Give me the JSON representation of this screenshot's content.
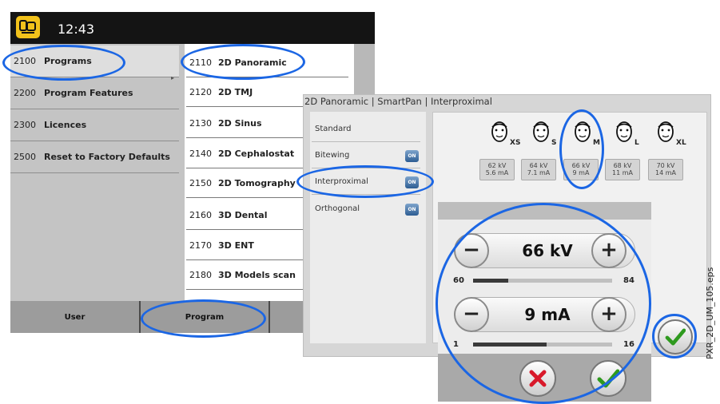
{
  "header": {
    "time": "12:43",
    "app_icon": "device-icon"
  },
  "left_menu": [
    {
      "code": "2100",
      "label": "Programs",
      "selected": true
    },
    {
      "code": "2200",
      "label": "Program Features"
    },
    {
      "code": "2300",
      "label": "Licences"
    },
    {
      "code": "2500",
      "label": "Reset to Factory Defaults"
    }
  ],
  "program_menu": [
    {
      "code": "2110",
      "label": "2D Panoramic"
    },
    {
      "code": "2120",
      "label": "2D TMJ"
    },
    {
      "code": "2130",
      "label": "2D Sinus"
    },
    {
      "code": "2140",
      "label": "2D Cephalostat"
    },
    {
      "code": "2150",
      "label": "2D Tomography"
    },
    {
      "code": "2160",
      "label": "3D Dental"
    },
    {
      "code": "2170",
      "label": "3D ENT"
    },
    {
      "code": "2180",
      "label": "3D Models scan"
    }
  ],
  "bottom_tabs": [
    {
      "label": "User"
    },
    {
      "label": "Program"
    }
  ],
  "panel": {
    "title": "2D Panoramic | SmartPan | Interproximal",
    "options": [
      {
        "label": "Standard",
        "badge": ""
      },
      {
        "label": "Bitewing",
        "badge": "ON"
      },
      {
        "label": "Interproximal",
        "badge": "ON"
      },
      {
        "label": "Orthogonal",
        "badge": "ON"
      }
    ],
    "patient_sizes": [
      {
        "size": "XS",
        "kv": "62 kV",
        "ma": "5.6 mA"
      },
      {
        "size": "S",
        "kv": "64 kV",
        "ma": "7.1 mA"
      },
      {
        "size": "M",
        "kv": "66 kV",
        "ma": "9 mA"
      },
      {
        "size": "L",
        "kv": "68 kV",
        "ma": "11 mA"
      },
      {
        "size": "XL",
        "kv": "70 kV",
        "ma": "14 mA"
      }
    ],
    "kv_control": {
      "value": "66 kV",
      "min": "60",
      "max": "84",
      "level": 0.25
    },
    "ma_control": {
      "value": "9 mA",
      "min": "1",
      "max": "16",
      "level": 0.53
    },
    "minus_symbol": "−",
    "plus_symbol": "+"
  },
  "side_label": "PXR_2D_UM_105.eps",
  "colors": {
    "highlight_ring": "#1b66e4",
    "on_badge": "#2d5d93",
    "cancel": "#d8192a",
    "confirm": "#2e9a1e"
  }
}
